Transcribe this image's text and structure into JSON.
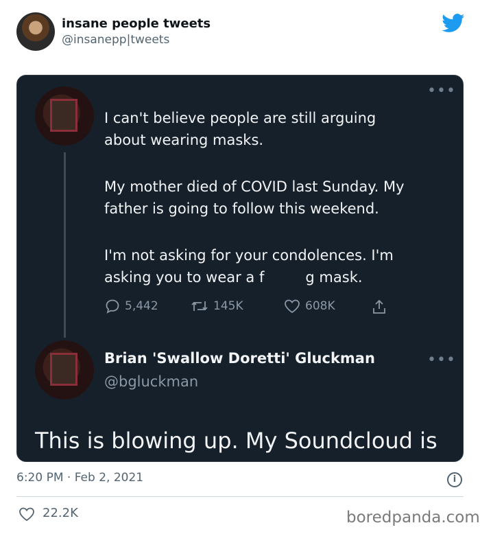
{
  "author": {
    "name": "insane people tweets",
    "handle": "@insanepp|tweets"
  },
  "embedded_tweet": {
    "paragraphs": [
      "I can't believe people are still arguing\nabout wearing masks.",
      "My mother died of COVID last Sunday. My\nfather is going to follow this weekend.",
      "I'm not asking for your condolences. I'm\nasking you to wear a f         g mask."
    ],
    "actions": {
      "replies": "5,442",
      "retweets": "145K",
      "likes": "608K"
    }
  },
  "reply_tweet": {
    "name": "Brian 'Swallow Doretti' Gluckman",
    "handle": "@bgluckman",
    "text": "This is blowing up. My Soundcloud is"
  },
  "footer": {
    "timestamp": "6:20 PM · Feb 2, 2021",
    "likes": "22.2K",
    "watermark": "boredpanda.com"
  },
  "colors": {
    "card_background": "#15202b",
    "twitter_blue": "#1d9bf0"
  },
  "icons": [
    "twitter-bird-icon",
    "more-dots-icon",
    "reply-icon",
    "retweet-icon",
    "like-icon",
    "share-icon",
    "info-icon",
    "heart-icon"
  ]
}
